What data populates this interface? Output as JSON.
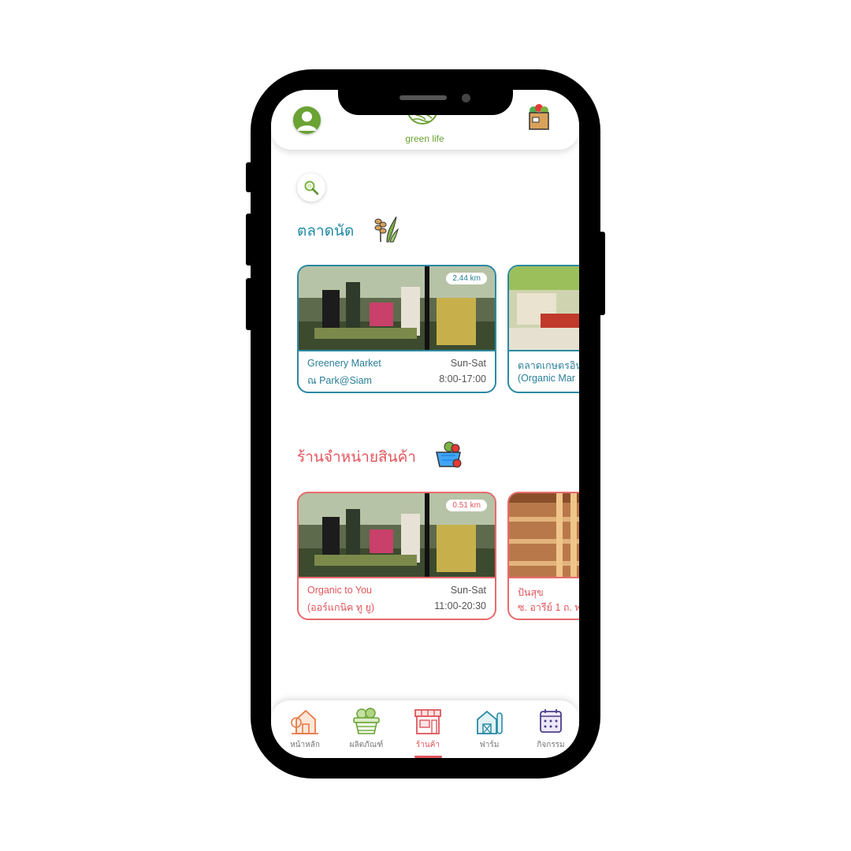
{
  "app": {
    "brand_name": "green life"
  },
  "header": {
    "avatar_icon": "user-avatar-icon",
    "logo_icon": "leaf-globe-logo",
    "cart_icon": "grocery-bag-icon"
  },
  "search": {
    "icon": "search-icon"
  },
  "sections": {
    "markets": {
      "title": "ตลาดนัด",
      "icon": "rice-plant-icon",
      "accent": "#2a8aa3",
      "cards": [
        {
          "distance": "2.44 km",
          "name_line1": "Greenery Market",
          "name_line2": "ณ Park@Siam",
          "days": "Sun-Sat",
          "hours": "8:00-17:00"
        },
        {
          "name_line1": "ตลาดเกษตรอิน",
          "name_line2": "(Organic Mar"
        }
      ]
    },
    "shops": {
      "title": "ร้านจำหน่ายสินค้า",
      "icon": "vegetable-basket-icon",
      "accent": "#e0565c",
      "cards": [
        {
          "distance": "0.51 km",
          "name_line1": "Organic to You",
          "name_line2": "(ออร์แกนิค ทู ยู)",
          "days": "Sun-Sat",
          "hours": "11:00-20:30"
        },
        {
          "name_line1": "ปันสุข",
          "name_line2": "ซ. อารีย์ 1 ถ. พ"
        }
      ]
    }
  },
  "nav": {
    "items": [
      {
        "label": "หน้าหลัก",
        "icon": "home-icon"
      },
      {
        "label": "ผลิตภัณฑ์",
        "icon": "basket-icon"
      },
      {
        "label": "ร้านค้า",
        "icon": "store-icon",
        "active": true
      },
      {
        "label": "ฟาร์ม",
        "icon": "barn-icon"
      },
      {
        "label": "กิจกรรม",
        "icon": "calendar-icon"
      }
    ]
  }
}
